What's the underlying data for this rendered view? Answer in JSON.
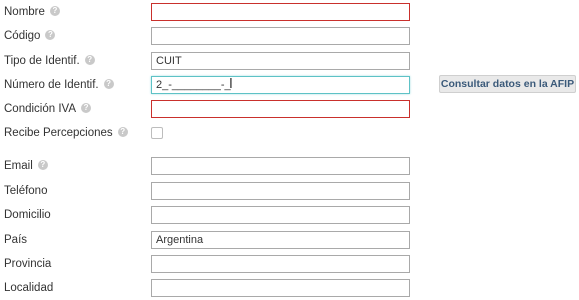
{
  "form": {
    "nombre": {
      "label": "Nombre",
      "value": ""
    },
    "codigo": {
      "label": "Código",
      "value": ""
    },
    "tipo_identif": {
      "label": "Tipo de Identif.",
      "value": "CUIT"
    },
    "numero_identif": {
      "label": "Número de Identif.",
      "value": "2_-________-_"
    },
    "condicion_iva": {
      "label": "Condición IVA",
      "value": ""
    },
    "recibe_percepciones": {
      "label": "Recibe Percepciones",
      "checked": false
    },
    "email": {
      "label": "Email",
      "value": ""
    },
    "telefono": {
      "label": "Teléfono",
      "value": ""
    },
    "domicilio": {
      "label": "Domicilio",
      "value": ""
    },
    "pais": {
      "label": "País",
      "value": "Argentina"
    },
    "provincia": {
      "label": "Provincia",
      "value": ""
    },
    "localidad": {
      "label": "Localidad",
      "value": ""
    }
  },
  "buttons": {
    "consultar_afip": "Consultar datos en la AFIP"
  },
  "icons": {
    "help": "help-circle-icon",
    "cursor": "text-cursor-icon"
  },
  "colors": {
    "error_border": "#c9302c",
    "focus_border": "#5ec2c6",
    "button_text": "#3b5a7a"
  }
}
